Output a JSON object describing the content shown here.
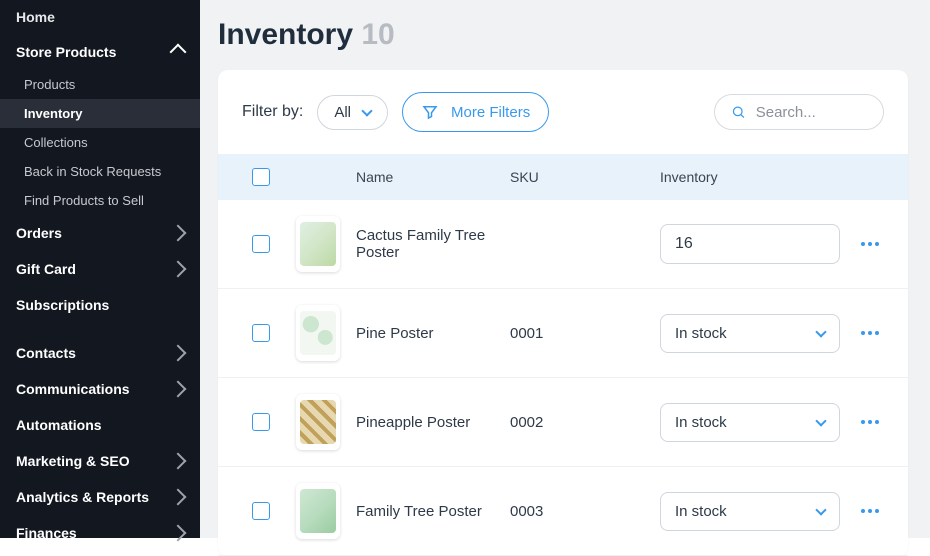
{
  "sidebar": {
    "home": "Home",
    "store_products": "Store Products",
    "subs": {
      "products": "Products",
      "inventory": "Inventory",
      "collections": "Collections",
      "back_in_stock": "Back in Stock Requests",
      "find_products": "Find Products to Sell"
    },
    "orders": "Orders",
    "gift_card": "Gift Card",
    "subscriptions": "Subscriptions",
    "contacts": "Contacts",
    "communications": "Communications",
    "automations": "Automations",
    "marketing_seo": "Marketing & SEO",
    "analytics_reports": "Analytics & Reports",
    "finances": "Finances"
  },
  "page": {
    "title": "Inventory",
    "count": "10"
  },
  "filter": {
    "label": "Filter by:",
    "all": "All",
    "more": "More Filters",
    "search_placeholder": "Search..."
  },
  "columns": {
    "name": "Name",
    "sku": "SKU",
    "inventory": "Inventory"
  },
  "rows": [
    {
      "name": "Cactus Family Tree Poster",
      "sku": "",
      "inventory_type": "number",
      "inventory_value": "16"
    },
    {
      "name": "Pine Poster",
      "sku": "0001",
      "inventory_type": "select",
      "inventory_value": "In stock"
    },
    {
      "name": "Pineapple Poster",
      "sku": "0002",
      "inventory_type": "select",
      "inventory_value": "In stock"
    },
    {
      "name": "Family Tree Poster",
      "sku": "0003",
      "inventory_type": "select",
      "inventory_value": "In stock"
    }
  ]
}
